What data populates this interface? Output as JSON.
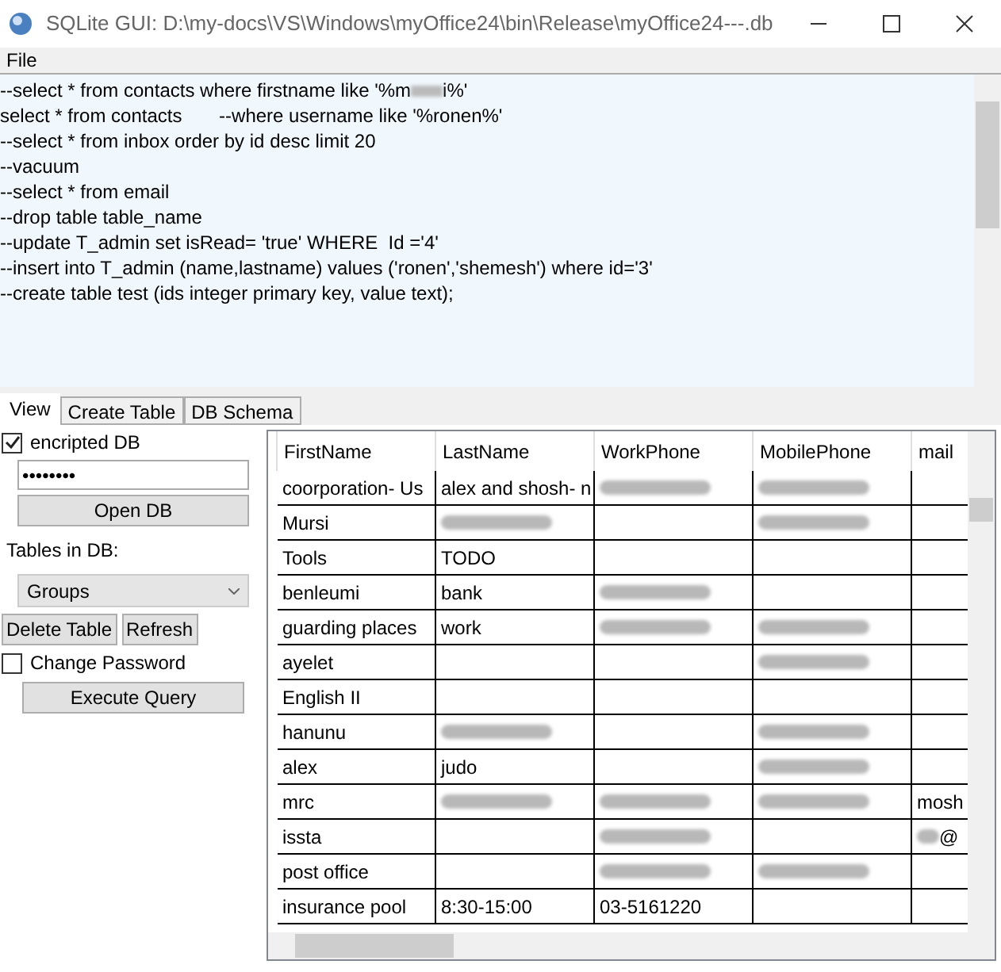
{
  "window": {
    "title": "SQLite GUI:  D:\\my-docs\\VS\\Windows\\myOffice24\\bin\\Release\\myOffice24---.db"
  },
  "menu": [
    "File"
  ],
  "query_lines": [
    {
      "text": "--select * from contacts where firstname like '%m",
      "blurred": true,
      "after": "i%'"
    },
    {
      "text": "select * from contacts       --where username like '%ronen%'"
    },
    {
      "text": "--select * from inbox order by id desc limit 20"
    },
    {
      "text": "--vacuum"
    },
    {
      "text": "--select * from email"
    },
    {
      "text": "--drop table table_name"
    },
    {
      "text": "--update T_admin set isRead= 'true' WHERE  Id ='4'"
    },
    {
      "text": "--insert into T_admin (name,lastname) values ('ronen','shemesh') where id='3'"
    },
    {
      "text": "--create table test (ids integer primary key, value text);"
    }
  ],
  "tabs": [
    {
      "label": "View",
      "selected": true
    },
    {
      "label": "Create Table",
      "selected": false
    },
    {
      "label": "DB Schema",
      "selected": false
    }
  ],
  "encrypted": {
    "label": "encripted DB",
    "checked": true
  },
  "password": {
    "value": "••••••••"
  },
  "open_button": "Open DB",
  "tables_label": "Tables in DB:",
  "tables_select": {
    "value": "Groups"
  },
  "delete_button": "Delete Table",
  "refresh_button": "Refresh",
  "change_password": {
    "label": "Change Password",
    "checked": false
  },
  "execute_button": "Execute Query",
  "grid": {
    "columns": [
      "FirstName",
      "LastName",
      "WorkPhone",
      "MobilePhone",
      "mail"
    ],
    "rows": [
      [
        {
          "text": "coorporation-  Us"
        },
        {
          "text": "alex and shosh- n"
        },
        {
          "blurred": true
        },
        {
          "blurred": true
        },
        {}
      ],
      [
        {
          "text": "Mursi"
        },
        {
          "blurred": true
        },
        {},
        {
          "blurred": true
        },
        {}
      ],
      [
        {
          "text": "Tools"
        },
        {
          "text": "TODO"
        },
        {},
        {},
        {}
      ],
      [
        {
          "text": "benleumi"
        },
        {
          "text": "bank"
        },
        {
          "blurred": true
        },
        {},
        {}
      ],
      [
        {
          "text": "guarding places"
        },
        {
          "text": "work"
        },
        {
          "blurred": true
        },
        {
          "blurred": true
        },
        {}
      ],
      [
        {
          "text": "ayelet"
        },
        {},
        {},
        {
          "blurred": true
        },
        {}
      ],
      [
        {
          "text": "English II"
        },
        {},
        {},
        {},
        {}
      ],
      [
        {
          "text": "hanunu"
        },
        {
          "blurred": true
        },
        {},
        {
          "blurred": true
        },
        {}
      ],
      [
        {
          "text": "alex"
        },
        {
          "text": "judo"
        },
        {},
        {
          "blurred": true
        },
        {}
      ],
      [
        {
          "text": "mrc"
        },
        {
          "blurred": true
        },
        {
          "blurred": true
        },
        {
          "blurred": true
        },
        {
          "text": "mosh"
        }
      ],
      [
        {
          "text": "issta"
        },
        {},
        {
          "blurred": true
        },
        {},
        {
          "blurred": true,
          "text": "@"
        }
      ],
      [
        {
          "text": "post office"
        },
        {},
        {
          "blurred": true
        },
        {
          "blurred": true
        },
        {}
      ],
      [
        {
          "text": "insurance pool"
        },
        {
          "text": "8:30-15:00"
        },
        {
          "text": "03-5161220"
        },
        {},
        {}
      ]
    ]
  }
}
